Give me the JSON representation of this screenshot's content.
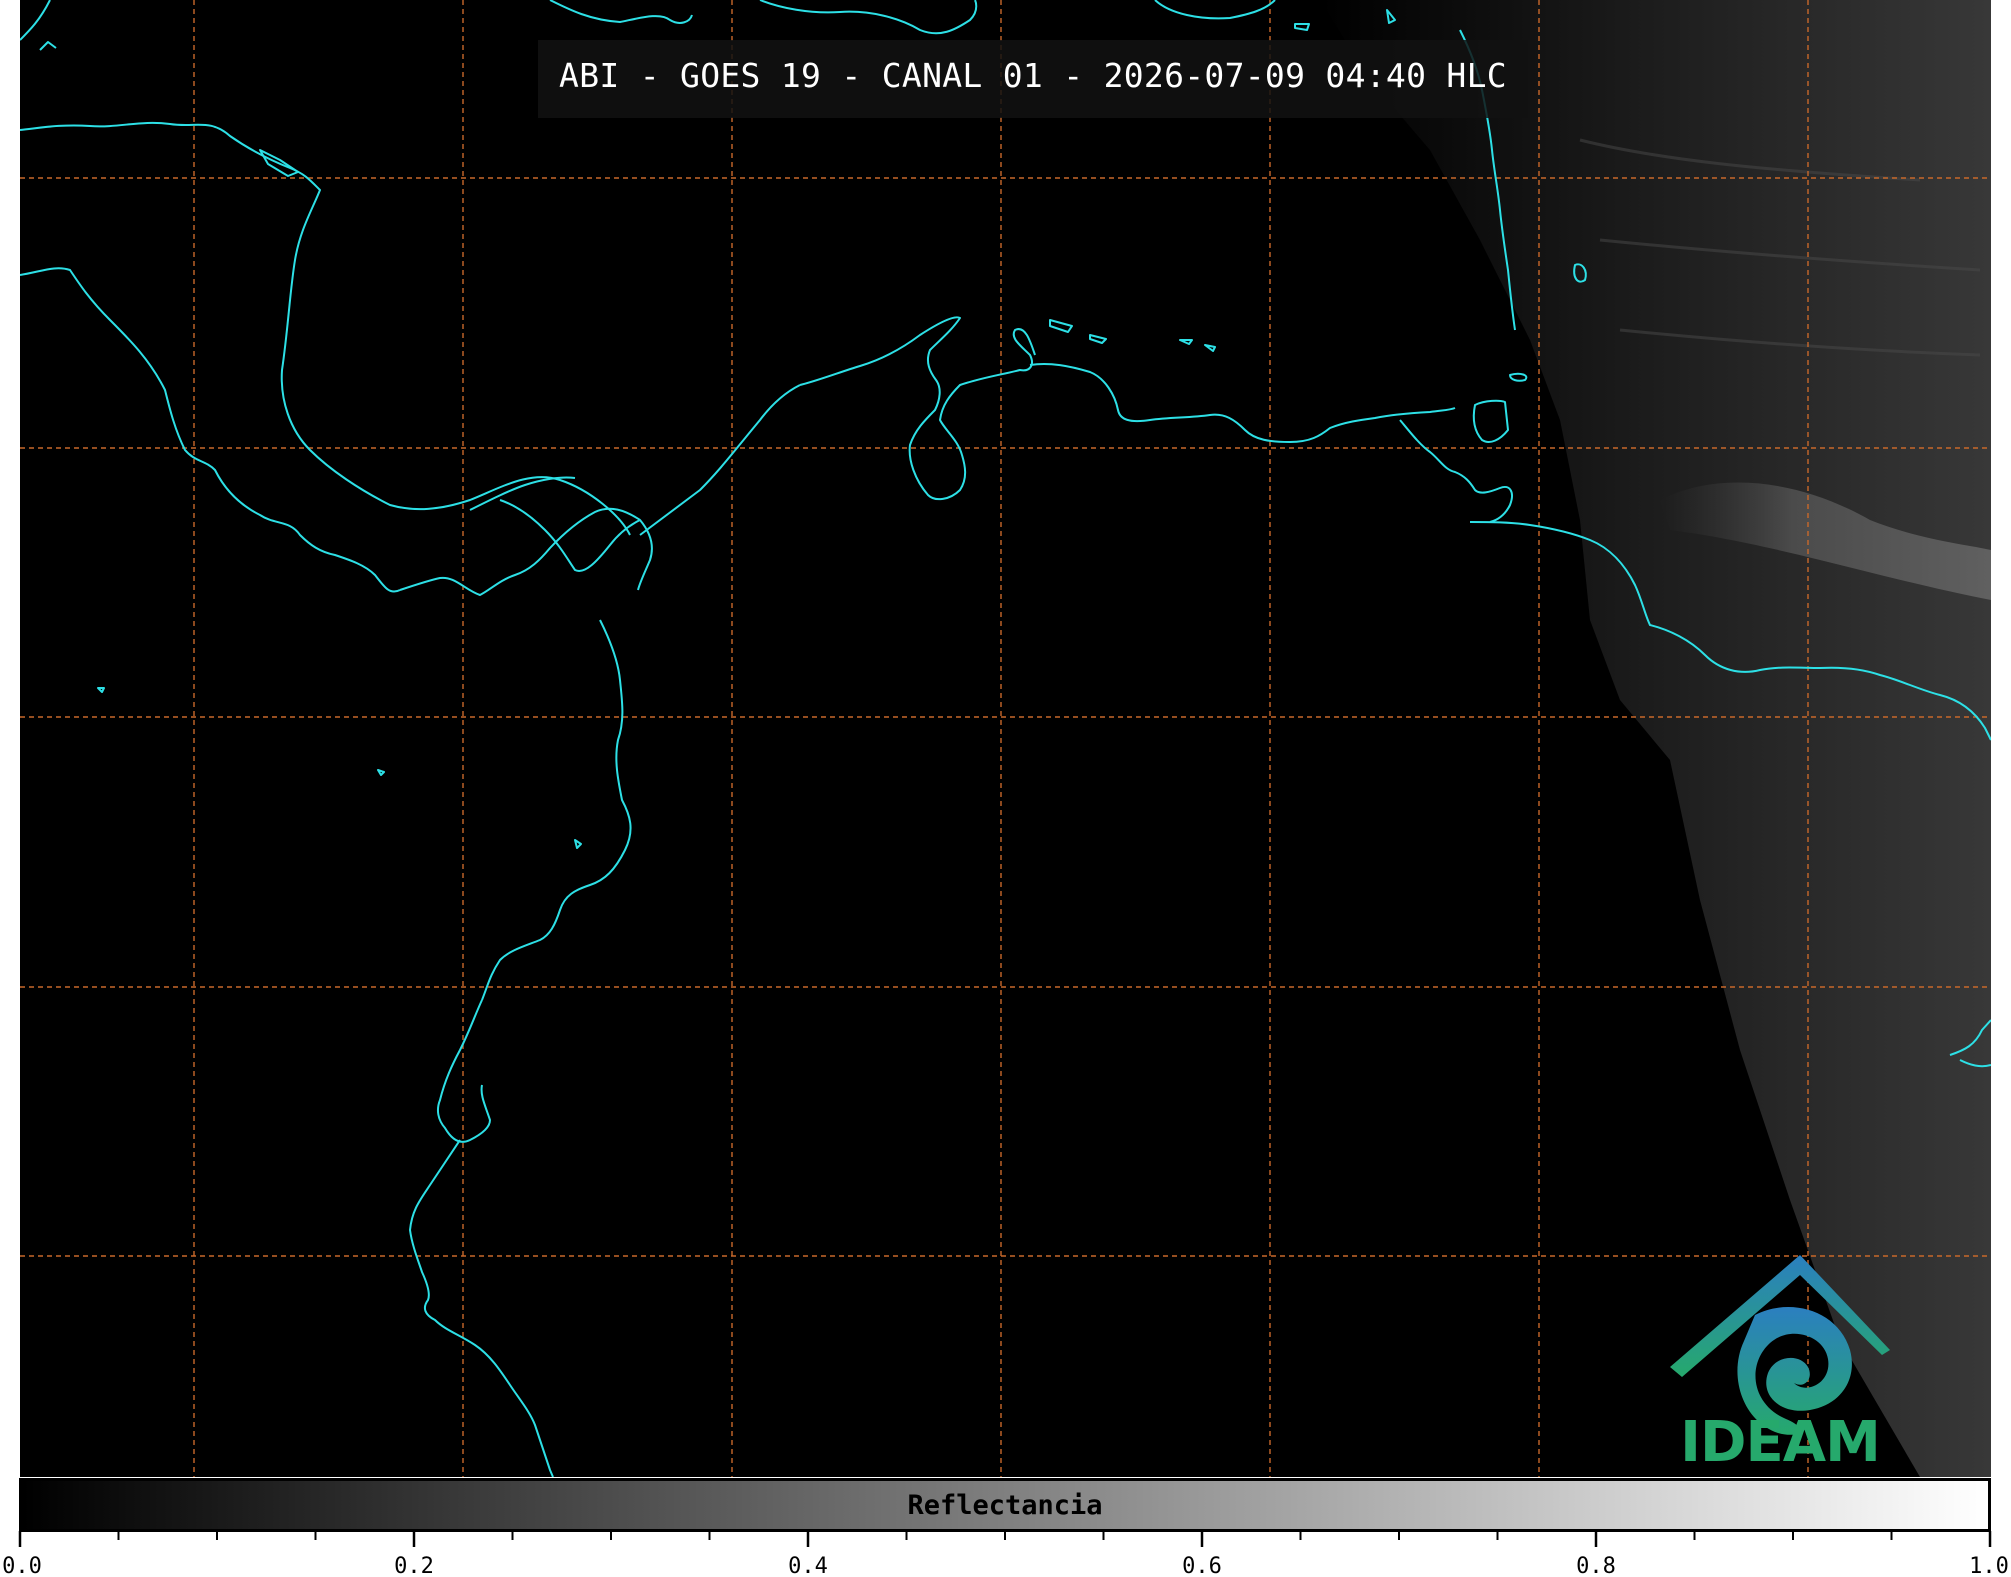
{
  "title": "ABI - GOES 19 - CANAL 01 - 2026-07-09 04:40 HLC",
  "logo": {
    "text": "IDEAM",
    "icon": "ideam-logo-icon"
  },
  "colorbar": {
    "label": "Reflectancia",
    "range": [
      0.0,
      1.0
    ],
    "tick_labels": [
      "0.0",
      "0.2",
      "0.4",
      "0.6",
      "0.8",
      "1.0"
    ],
    "colormap": "black-to-white"
  },
  "colors": {
    "coastline": "#2de0e6",
    "gridlines": "#c8682a",
    "background": "#000000",
    "logo_blue": "#2b7fc0",
    "logo_green": "#26a96c"
  },
  "map": {
    "gridlines": true,
    "gridline_style": "dashed"
  }
}
